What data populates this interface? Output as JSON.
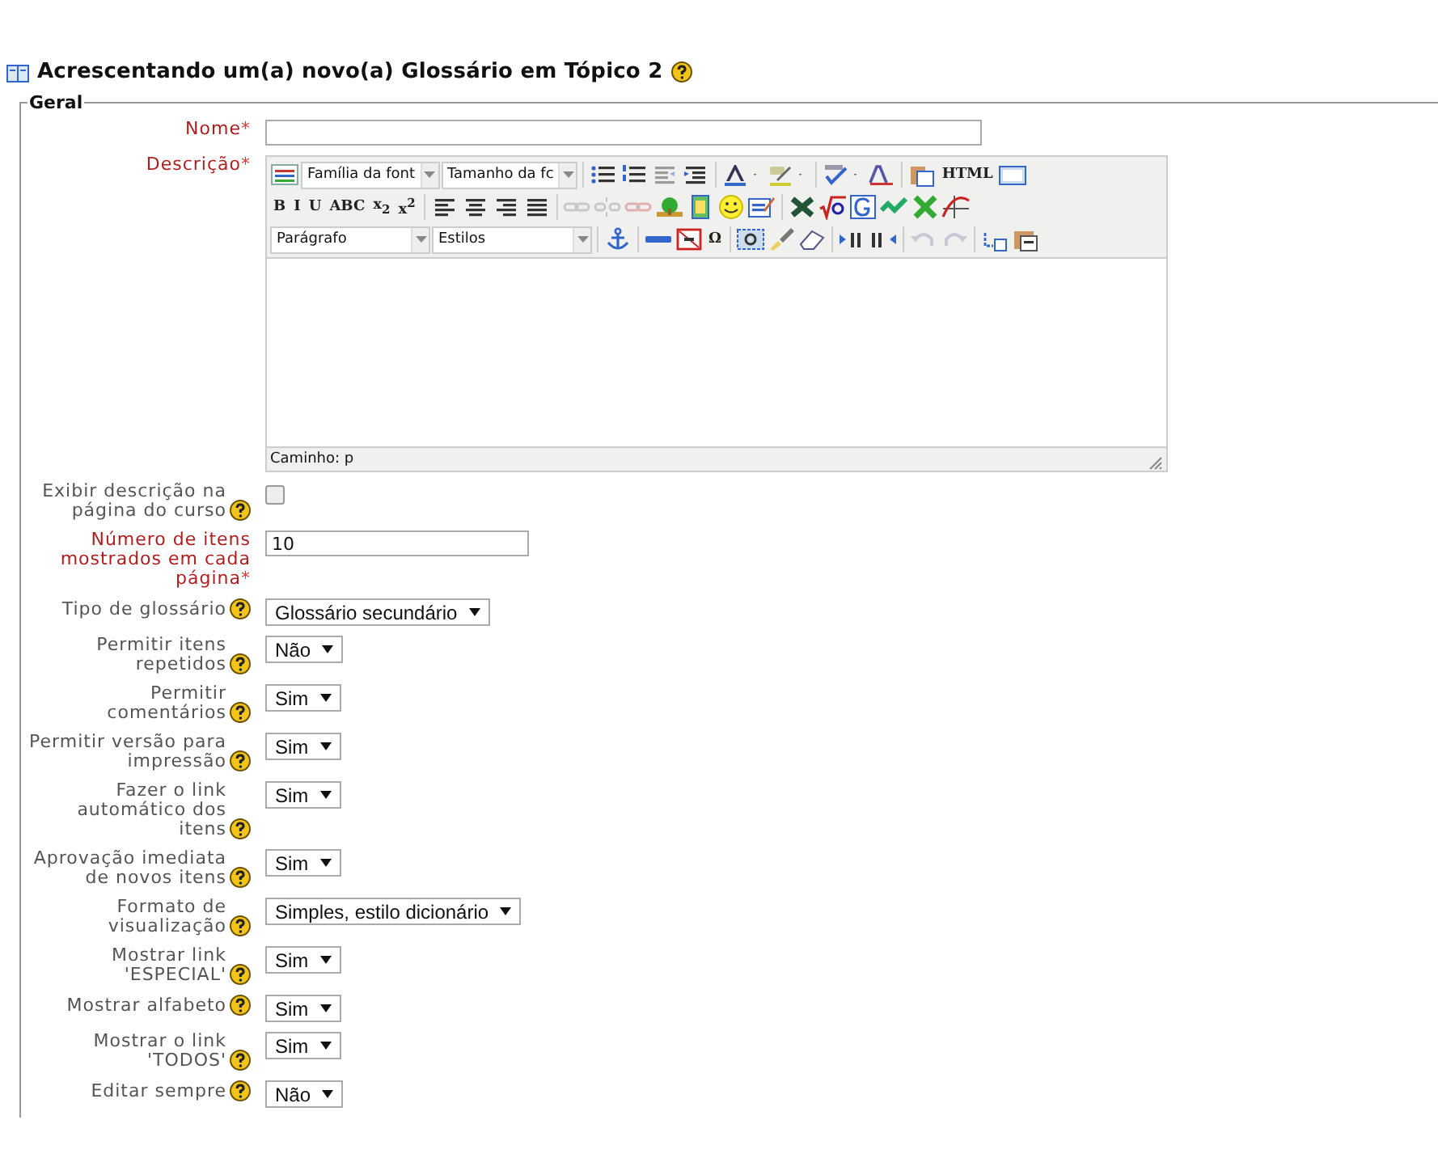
{
  "page": {
    "title": "Acrescentando um(a) novo(a) Glossário em Tópico 2"
  },
  "fieldset": {
    "legend": "Geral"
  },
  "editor": {
    "toolbar": [
      [
        {
          "kind": "icon",
          "disabled": false
        },
        {
          "kind": "select",
          "label": "Família da font"
        },
        {
          "kind": "select",
          "label": "Tamanho da fc"
        },
        {
          "kind": "sep"
        },
        {
          "kind": "icon",
          "disabled": false
        },
        {
          "kind": "icon",
          "disabled": false
        },
        {
          "kind": "icon",
          "disabled": true
        },
        {
          "kind": "icon",
          "disabled": false
        },
        {
          "kind": "sep"
        },
        {
          "kind": "icon",
          "disabled": false
        },
        {
          "kind": "icon",
          "disabled": false
        },
        {
          "kind": "icon",
          "disabled": false
        },
        {
          "kind": "icon",
          "disabled": false
        },
        {
          "kind": "sep"
        },
        {
          "kind": "icon",
          "disabled": false
        },
        {
          "kind": "icon",
          "disabled": false
        },
        {
          "kind": "icon",
          "disabled": false
        },
        {
          "kind": "sep"
        },
        {
          "kind": "icon",
          "disabled": false
        },
        {
          "kind": "glyph",
          "label": "HTML"
        },
        {
          "kind": "icon",
          "disabled": false
        }
      ],
      [
        {
          "kind": "glyph",
          "label": "B"
        },
        {
          "kind": "glyph",
          "label": "I"
        },
        {
          "kind": "glyph",
          "label": "U"
        },
        {
          "kind": "glyph",
          "label": "ABC"
        },
        {
          "kind": "glyph",
          "label": "x$_{2}$"
        },
        {
          "kind": "glyph",
          "label": "x$^{2}$"
        },
        {
          "kind": "sep"
        },
        {
          "kind": "icon",
          "disabled": false
        },
        {
          "kind": "icon",
          "disabled": false
        },
        {
          "kind": "icon",
          "disabled": false
        },
        {
          "kind": "icon",
          "disabled": false
        },
        {
          "kind": "sep"
        },
        {
          "kind": "icon",
          "disabled": true
        },
        {
          "kind": "icon",
          "disabled": true
        },
        {
          "kind": "icon",
          "disabled": true
        },
        {
          "kind": "icon",
          "disabled": false
        },
        {
          "kind": "icon",
          "disabled": false
        },
        {
          "kind": "icon",
          "disabled": false
        },
        {
          "kind": "icon",
          "disabled": false
        },
        {
          "kind": "sep"
        },
        {
          "kind": "icon",
          "disabled": false
        },
        {
          "kind": "icon",
          "disabled": false
        },
        {
          "kind": "icon",
          "disabled": false
        },
        {
          "kind": "icon",
          "disabled": false
        },
        {
          "kind": "icon",
          "disabled": false
        },
        {
          "kind": "icon",
          "disabled": false
        }
      ],
      [
        {
          "kind": "select",
          "label": "Parágrafo"
        },
        {
          "kind": "select",
          "label": "Estilos"
        },
        {
          "kind": "sep"
        },
        {
          "kind": "icon",
          "disabled": false
        },
        {
          "kind": "sep"
        },
        {
          "kind": "icon",
          "disabled": false
        },
        {
          "kind": "icon",
          "disabled": false
        },
        {
          "kind": "glyph",
          "label": "Ω"
        },
        {
          "kind": "sep"
        },
        {
          "kind": "icon",
          "disabled": false
        },
        {
          "kind": "icon",
          "disabled": false
        },
        {
          "kind": "icon",
          "disabled": false
        },
        {
          "kind": "sep"
        },
        {
          "kind": "icon",
          "disabled": false
        },
        {
          "kind": "icon",
          "disabled": false
        },
        {
          "kind": "sep"
        },
        {
          "kind": "icon",
          "disabled": true
        },
        {
          "kind": "icon",
          "disabled": true
        },
        {
          "kind": "sep"
        },
        {
          "kind": "icon",
          "disabled": false
        },
        {
          "kind": "icon",
          "disabled": false
        }
      ]
    ],
    "path": "Caminho: p"
  },
  "fields": [
    {
      "label": "Nome",
      "required": true,
      "required_mark": "*",
      "help": false,
      "control": {
        "kind": "text"
      }
    },
    {
      "label": "Descrição",
      "required": true,
      "required_mark": "*",
      "help": false,
      "control": {
        "kind": "editor"
      }
    },
    {
      "label": "Exibir descrição na página do curso",
      "required": false,
      "help": true,
      "control": {
        "kind": "checkbox",
        "checked": false
      }
    },
    {
      "label": "Número de itens mostrados em cada página",
      "required": true,
      "required_mark": "*",
      "help": false,
      "control": {
        "kind": "text",
        "value": "10"
      }
    },
    {
      "label": "Tipo de glossário",
      "required": false,
      "help": true,
      "control": {
        "kind": "select",
        "value": "Glossário secundário"
      }
    },
    {
      "label": "Permitir itens repetidos",
      "required": false,
      "help": true,
      "control": {
        "kind": "select",
        "value": "Não"
      }
    },
    {
      "label": "Permitir comentários",
      "required": false,
      "help": true,
      "control": {
        "kind": "select",
        "value": "Sim"
      }
    },
    {
      "label": "Permitir versão para impressão",
      "required": false,
      "help": true,
      "control": {
        "kind": "select",
        "value": "Sim"
      }
    },
    {
      "label": "Fazer o link automático dos itens",
      "required": false,
      "help": true,
      "control": {
        "kind": "select",
        "value": "Sim"
      }
    },
    {
      "label": "Aprovação imediata de novos itens",
      "required": false,
      "help": true,
      "control": {
        "kind": "select",
        "value": "Sim"
      }
    },
    {
      "label": "Formato de visualização",
      "required": false,
      "help": true,
      "control": {
        "kind": "select",
        "value": "Simples, estilo dicionário"
      }
    },
    {
      "label": "Mostrar link 'ESPECIAL'",
      "required": false,
      "help": true,
      "control": {
        "kind": "select",
        "value": "Sim"
      }
    },
    {
      "label": "Mostrar alfabeto",
      "required": false,
      "help": true,
      "control": {
        "kind": "select",
        "value": "Sim"
      }
    },
    {
      "label": "Mostrar o link 'TODOS'",
      "required": false,
      "help": true,
      "control": {
        "kind": "select",
        "value": "Sim"
      }
    },
    {
      "label": "Editar sempre",
      "required": false,
      "help": true,
      "control": {
        "kind": "select",
        "value": "Não"
      }
    }
  ]
}
